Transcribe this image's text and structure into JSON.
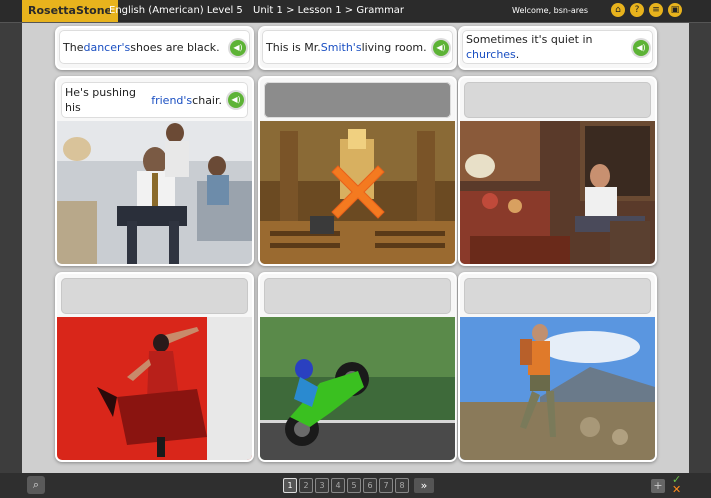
{
  "header": {
    "brand": "RosettaStone",
    "course": "English (American) Level 5",
    "breadcrumb": "Unit 1 > Lesson 1 > Grammar",
    "welcome": "Welcome, bsn-ares",
    "icons": [
      "home-icon",
      "help-icon",
      "settings-icon",
      "exit-icon"
    ]
  },
  "cards": [
    {
      "text_before": "The ",
      "highlight": "dancer's",
      "text_after": " shoes are black.",
      "image": "dancer-feet-photo"
    },
    {
      "text_before": "This is Mr. ",
      "highlight": "Smith's",
      "text_after": " living room.",
      "image": "living-room-photo"
    },
    {
      "text_before": "Sometimes it's quiet in ",
      "highlight": "churches",
      "text_after": ".",
      "image": "church-photo"
    },
    {
      "text_before": "He's pushing his ",
      "highlight": "friend's",
      "text_after": " chair.",
      "image": "office-chair-photo"
    },
    {
      "text_before": "",
      "highlight": "",
      "text_after": "",
      "image": "church-interior-photo",
      "marked_wrong": true
    },
    {
      "text_before": "",
      "highlight": "",
      "text_after": "",
      "image": "man-in-chair-photo"
    },
    {
      "text_before": "",
      "highlight": "",
      "text_after": "",
      "image": "flamenco-dancer-photo"
    },
    {
      "text_before": "",
      "highlight": "",
      "text_after": "",
      "image": "motorcycle-wheelie-photo"
    },
    {
      "text_before": "",
      "highlight": "",
      "text_after": "",
      "image": "hiker-photo"
    }
  ],
  "pager": {
    "pages": [
      "1",
      "2",
      "3",
      "4",
      "5",
      "6",
      "7",
      "8"
    ],
    "current": "1",
    "next_label": "»"
  },
  "colors": {
    "brand_yellow": "#e8b31d",
    "highlight_blue": "#1a4fc2",
    "speaker_green": "#5db336",
    "wrong_orange": "#f47a20"
  }
}
